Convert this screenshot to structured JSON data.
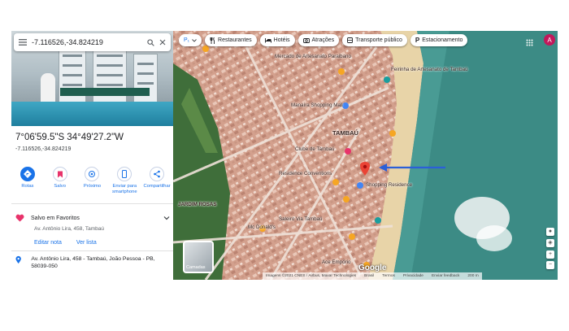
{
  "search": {
    "query": "-7.116526,-34.824219"
  },
  "place": {
    "title": "7°06'59.5\"S 34°49'27.2\"W",
    "coords": "-7.116526,-34.824219"
  },
  "actions": [
    {
      "label": "Rotas",
      "icon": "directions-icon"
    },
    {
      "label": "Salvo",
      "icon": "bookmark-icon"
    },
    {
      "label": "Próximo",
      "icon": "nearby-icon"
    },
    {
      "label": "Enviar para smartphone",
      "icon": "send-to-phone-icon"
    },
    {
      "label": "Compartilhar",
      "icon": "share-icon"
    }
  ],
  "saved": {
    "label": "Salvo em Favoritos",
    "address": "Av. Antônio Lira, 458, Tambaú",
    "edit_label": "Editar nota",
    "view_list_label": "Ver lista"
  },
  "address_full": "Av. Antônio Lira, 458 - Tambaú, João Pessoa - PB, 58039-050",
  "map": {
    "chips": [
      {
        "label": "Restaurantes",
        "icon": "fork-knife-icon"
      },
      {
        "label": "Hotéis",
        "icon": "bed-icon"
      },
      {
        "label": "Atrações",
        "icon": "camera-icon"
      },
      {
        "label": "Transporte público",
        "icon": "bus-icon"
      },
      {
        "label": "Estacionamento",
        "icon": "parking-icon"
      }
    ],
    "avatar_letter": "A",
    "layers_label": "Camadas",
    "neighborhoods": {
      "tambau": "TAMBAÚ",
      "jardim": "JARDIM ROSAS"
    },
    "places": [
      "Mercado de Artesanato Paraibano",
      "Feirinha de Artesanato de Tambaú",
      "Manaíra Shopping Mall",
      "Clube de Tambaú",
      "Residence Conventions",
      "Shopping Residence",
      "Mc Donald's",
      "Saleiro Via Tambaú",
      "Ace Empório"
    ],
    "google_label": "Google",
    "attribution": [
      "Imagens ©2021 CNES / Airbus, Maxar Technologies",
      "Brasil",
      "Termos",
      "Privacidade",
      "Enviar feedback",
      "200 m"
    ],
    "colors": {
      "sea": "#3c8b85",
      "beach": "#e8d4a8",
      "city": "#d7a796",
      "pin": "#ea4335",
      "arrow": "#2b5fd8"
    }
  }
}
